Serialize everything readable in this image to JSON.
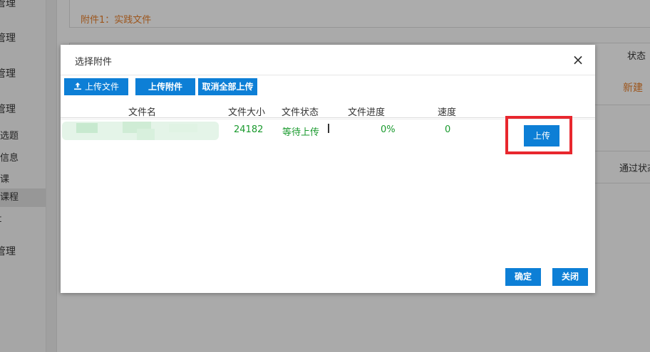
{
  "sidebar": {
    "items": [
      {
        "label": "管理"
      },
      {
        "label": "管理"
      },
      {
        "label": "管理"
      },
      {
        "label": "管理"
      },
      {
        "label": "选题"
      },
      {
        "label": "信息"
      },
      {
        "label": "课"
      },
      {
        "label": "课程"
      },
      {
        "label": "t"
      },
      {
        "label": "管理"
      }
    ]
  },
  "background": {
    "attachment_title": "附件1：实践文件",
    "status_header": "状态",
    "status_value": "新建",
    "pass_status_header": "通过状态"
  },
  "dialog": {
    "title": "选择附件",
    "close_symbol": "×",
    "toolbar": {
      "upload_file_label": "上传文件",
      "upload_attachment_label": "上传附件",
      "cancel_all_label": "取消全部上传"
    },
    "columns": [
      "文件名",
      "文件大小",
      "文件状态",
      "文件进度",
      "速度"
    ],
    "file_row": {
      "size": "24182",
      "status": "等待上传",
      "progress": "0%",
      "speed": "0",
      "upload_button_label": "上传"
    },
    "footer": {
      "confirm_label": "确定",
      "close_label": "关闭"
    }
  },
  "colors": {
    "primary": "#0d7fd6",
    "highlight": "#e8272e",
    "status_green": "#1a9a2e",
    "accent_orange": "#e07b2a"
  },
  "icons": {
    "upload": "upload-icon",
    "close": "close-icon"
  }
}
